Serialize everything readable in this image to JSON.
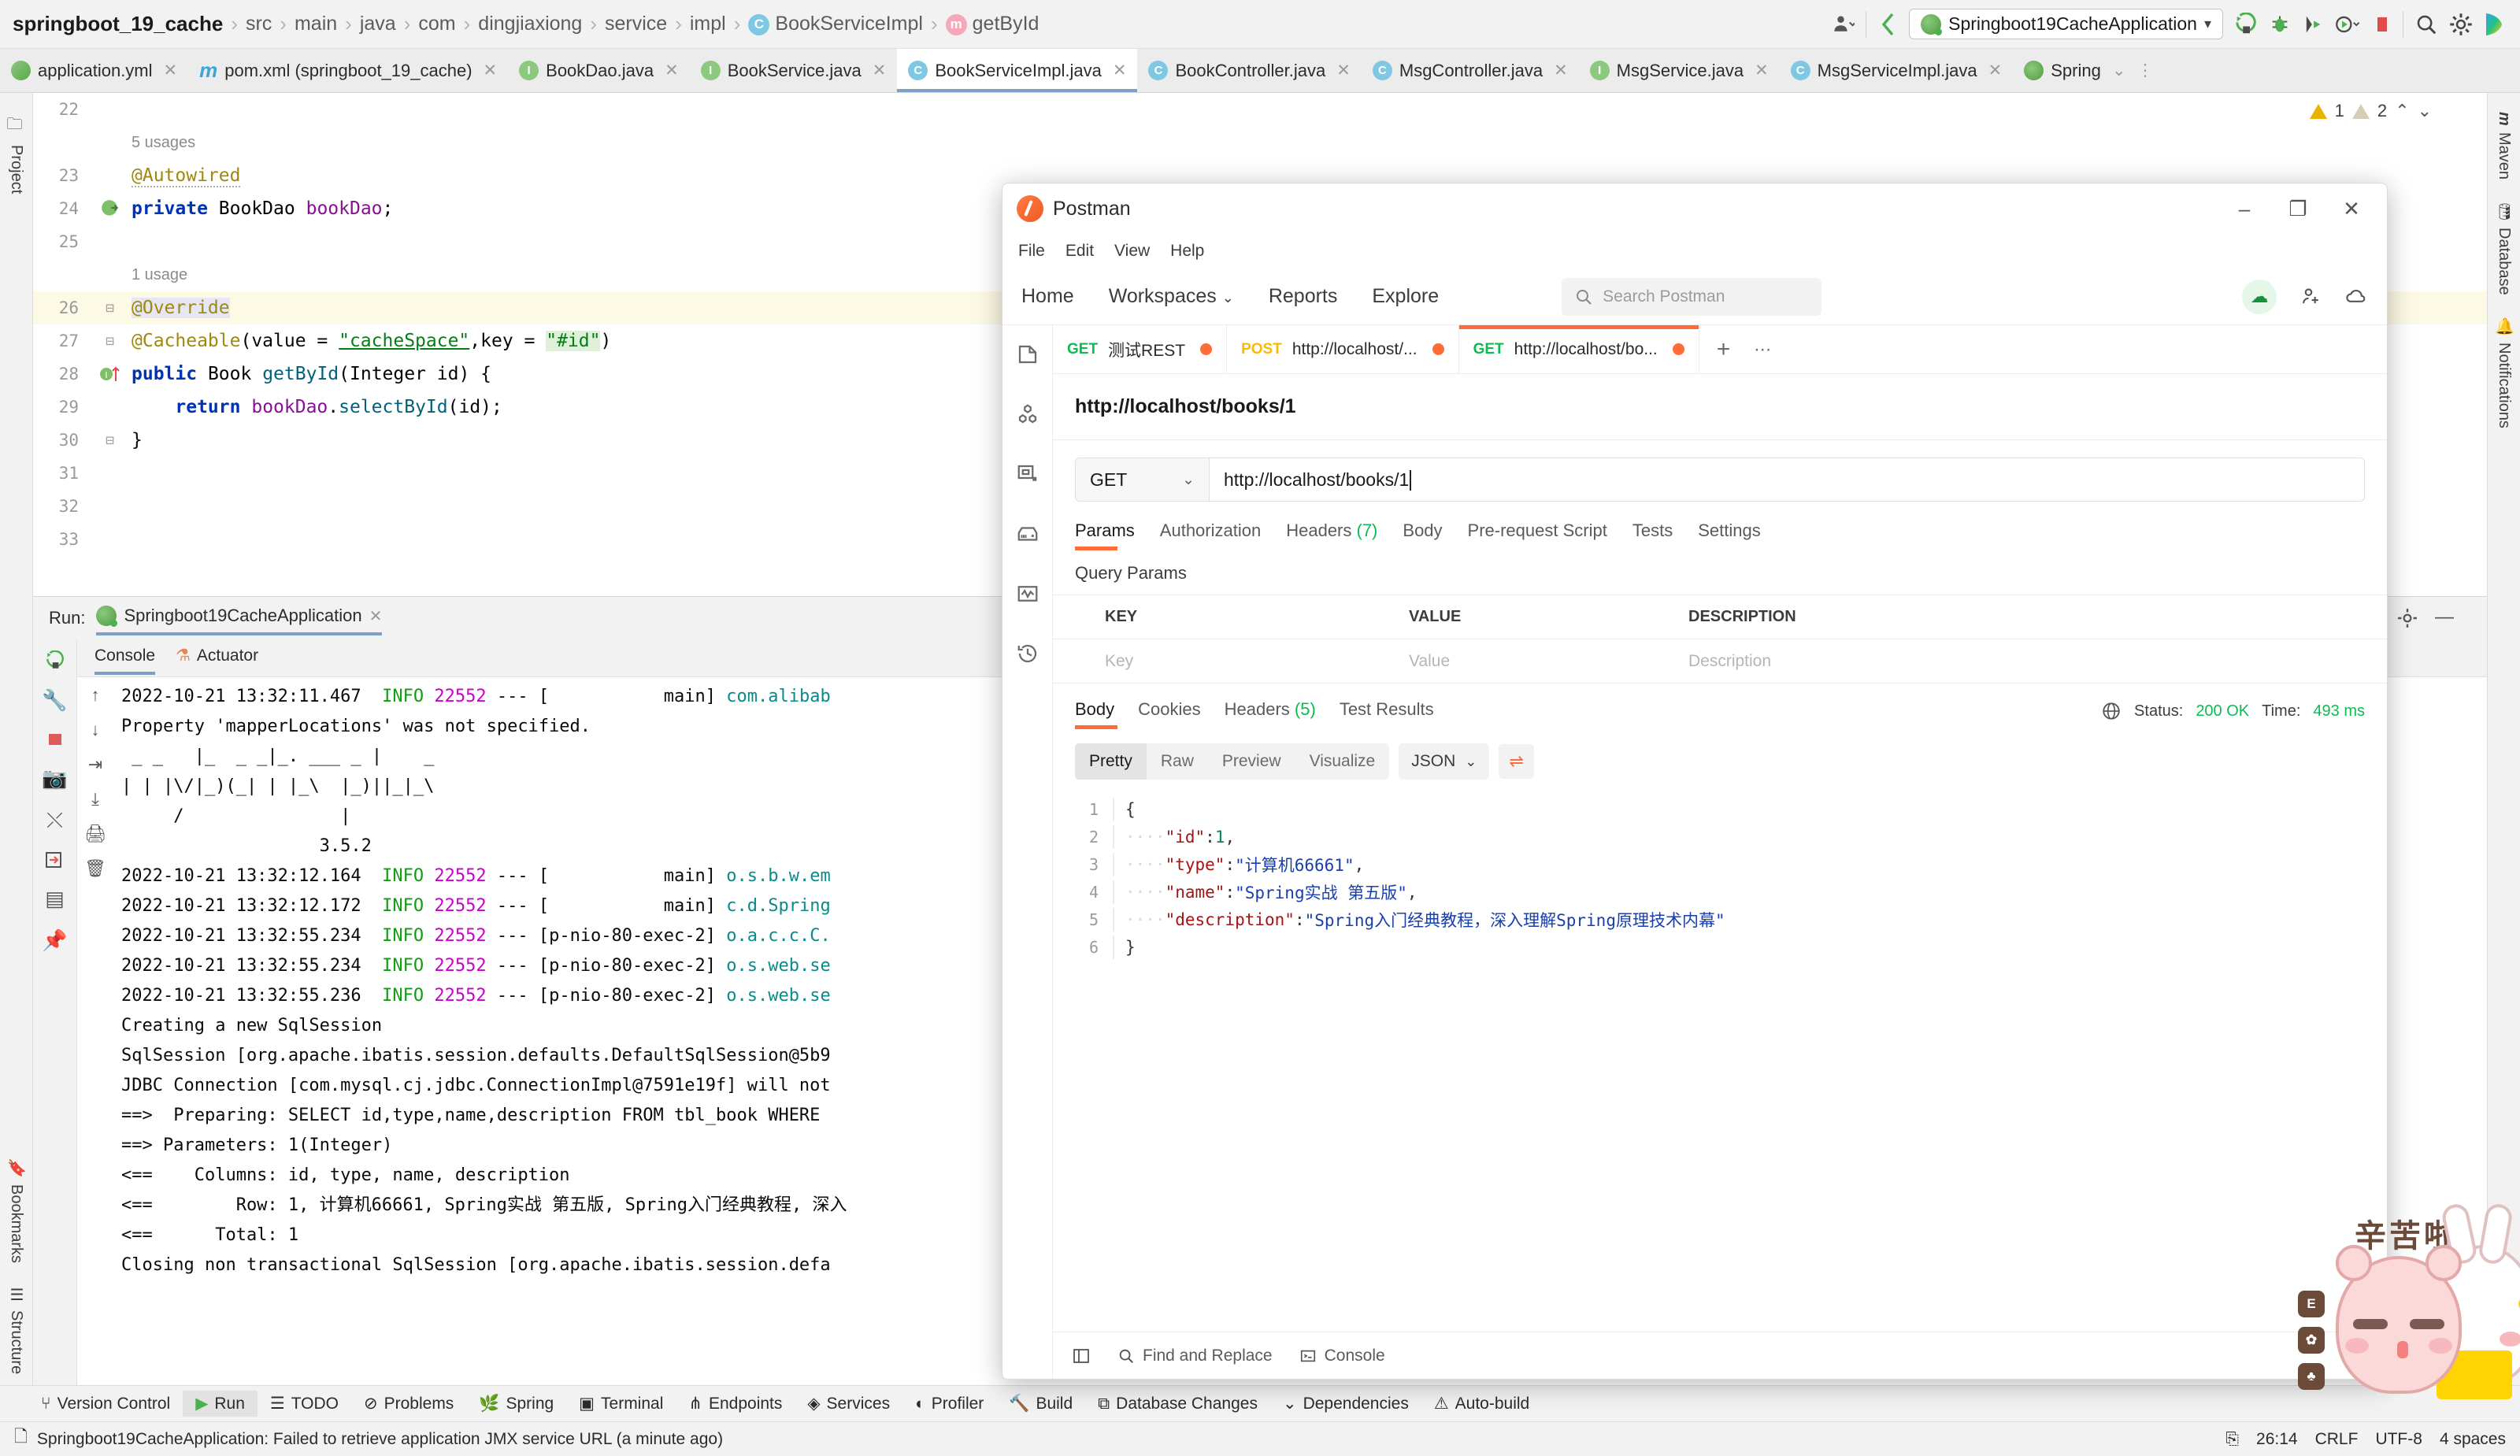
{
  "ide": {
    "breadcrumb": [
      {
        "label": "springboot_19_cache",
        "icon": "",
        "bold": true
      },
      {
        "label": "src",
        "icon": ""
      },
      {
        "label": "main",
        "icon": ""
      },
      {
        "label": "java",
        "icon": ""
      },
      {
        "label": "com",
        "icon": ""
      },
      {
        "label": "dingjiaxiong",
        "icon": ""
      },
      {
        "label": "service",
        "icon": ""
      },
      {
        "label": "impl",
        "icon": ""
      },
      {
        "label": "BookServiceImpl",
        "icon": "class-icon"
      },
      {
        "label": "getById",
        "icon": "method-icon"
      }
    ],
    "toolbar": {
      "run_config": "Springboot19CacheApplication",
      "run_icon": "run-icon",
      "debug_icon": "debug-icon",
      "coverage_icon": "coverage-icon",
      "profile_icon": "profile-icon",
      "stop_icon": "stop-icon",
      "search_icon": "search-icon",
      "settings_icon": "gear-icon",
      "user_icon": "user-icon",
      "back_icon": "back-arrow-icon"
    },
    "editor_tabs": [
      {
        "label": "application.yml",
        "icon": "yml-icon",
        "active": false
      },
      {
        "label": "pom.xml (springboot_19_cache)",
        "icon": "maven-icon",
        "active": false
      },
      {
        "label": "BookDao.java",
        "icon": "interface-icon",
        "active": false
      },
      {
        "label": "BookService.java",
        "icon": "interface-icon",
        "active": false
      },
      {
        "label": "BookServiceImpl.java",
        "icon": "class-icon",
        "active": true
      },
      {
        "label": "BookController.java",
        "icon": "class-icon",
        "active": false
      },
      {
        "label": "MsgController.java",
        "icon": "class-icon",
        "active": false
      },
      {
        "label": "MsgService.java",
        "icon": "interface-icon",
        "active": false
      },
      {
        "label": "MsgServiceImpl.java",
        "icon": "class-icon",
        "active": false
      },
      {
        "label": "Spring",
        "icon": "spring-icon",
        "active": false
      }
    ],
    "inspections": {
      "warnings": "1",
      "weak_warnings": "2"
    },
    "code": {
      "lines": [
        {
          "num": "22",
          "text": ""
        },
        {
          "num": "",
          "text": "5 usages",
          "kind": "usage"
        },
        {
          "num": "23",
          "text": "@Autowired",
          "kind": "annotation-squiggle"
        },
        {
          "num": "24",
          "text": "private BookDao bookDao;",
          "kind": "field",
          "gutter_icon": "bean-icon"
        },
        {
          "num": "25",
          "text": ""
        },
        {
          "num": "",
          "text": "1 usage",
          "kind": "usage"
        },
        {
          "num": "26",
          "text": "@Override",
          "kind": "override",
          "highlight": true,
          "fold": true
        },
        {
          "num": "27",
          "text": "@Cacheable(value = \"cacheSpace\",key = \"#id\")",
          "kind": "cacheable",
          "fold": true
        },
        {
          "num": "28",
          "text": "public Book getById(Integer id) {",
          "kind": "method",
          "gutter_icon": "implements-icon",
          "fold": true
        },
        {
          "num": "29",
          "text": "    return bookDao.selectById(id);",
          "kind": "return"
        },
        {
          "num": "30",
          "text": "}",
          "kind": "brace",
          "fold": true
        },
        {
          "num": "31",
          "text": ""
        },
        {
          "num": "32",
          "text": ""
        },
        {
          "num": "33",
          "text": ""
        }
      ]
    },
    "left_rail": [
      {
        "label": "Project",
        "icon": "project-icon"
      },
      {
        "label": "Bookmarks",
        "icon": "bookmark-icon"
      },
      {
        "label": "Structure",
        "icon": "structure-icon"
      }
    ],
    "right_rail": [
      {
        "label": "Maven",
        "icon": "maven-icon"
      },
      {
        "label": "Database",
        "icon": "database-icon"
      },
      {
        "label": "Notifications",
        "icon": "bell-icon"
      }
    ],
    "run_panel": {
      "label": "Run:",
      "config_name": "Springboot19CacheApplication",
      "tabs": [
        {
          "label": "Console",
          "icon": "console-icon",
          "active": true
        },
        {
          "label": "Actuator",
          "icon": "actuator-icon",
          "active": false
        }
      ],
      "console_lines": [
        "2022-10-21 13:32:11.467  <I>INFO</I> <P>22552</P> --- [           main] <C>com.alibab</C>",
        "Property 'mapperLocations' was not specified.",
        " _ _   |_  _ _|_. ___ _ |    _ ",
        "| | |\\/|_)(_| | |_\\  |_)||_|_\\ ",
        "     /               |         ",
        "                   3.5.2        ",
        "2022-10-21 13:32:12.164  <I>INFO</I> <P>22552</P> --- [           main] <C>o.s.b.w.em</C>",
        "2022-10-21 13:32:12.172  <I>INFO</I> <P>22552</P> --- [           main] <C>c.d.Spring</C>",
        "2022-10-21 13:32:55.234  <I>INFO</I> <P>22552</P> --- [p-nio-80-exec-2] <C>o.a.c.c.C.</C>",
        "2022-10-21 13:32:55.234  <I>INFO</I> <P>22552</P> --- [p-nio-80-exec-2] <C>o.s.web.se</C>",
        "2022-10-21 13:32:55.236  <I>INFO</I> <P>22552</P> --- [p-nio-80-exec-2] <C>o.s.web.se</C>",
        "Creating a new SqlSession",
        "SqlSession [org.apache.ibatis.session.defaults.DefaultSqlSession@5b9",
        "JDBC Connection [com.mysql.cj.jdbc.ConnectionImpl@7591e19f] will not",
        "==>  Preparing: SELECT id,type,name,description FROM tbl_book WHERE",
        "==> Parameters: 1(Integer)",
        "<==    Columns: id, type, name, description",
        "<==        Row: 1, 计算机66661, Spring实战 第五版, Spring入门经典教程, 深入",
        "<==      Total: 1",
        "Closing non transactional SqlSession [org.apache.ibatis.session.defa"
      ]
    },
    "tool_windows": [
      {
        "label": "Version Control",
        "icon": "branch-icon",
        "active": false
      },
      {
        "label": "Run",
        "icon": "run-icon",
        "active": true
      },
      {
        "label": "TODO",
        "icon": "todo-icon",
        "active": false
      },
      {
        "label": "Problems",
        "icon": "problems-icon",
        "active": false
      },
      {
        "label": "Spring",
        "icon": "spring-icon",
        "active": false
      },
      {
        "label": "Terminal",
        "icon": "terminal-icon",
        "active": false
      },
      {
        "label": "Endpoints",
        "icon": "endpoints-icon",
        "active": false
      },
      {
        "label": "Services",
        "icon": "services-icon",
        "active": false
      },
      {
        "label": "Profiler",
        "icon": "profiler-icon",
        "active": false
      },
      {
        "label": "Build",
        "icon": "build-icon",
        "active": false
      },
      {
        "label": "Database Changes",
        "icon": "db-changes-icon",
        "active": false
      },
      {
        "label": "Dependencies",
        "icon": "dependencies-icon",
        "active": false
      },
      {
        "label": "Auto-build",
        "icon": "auto-build-icon",
        "active": false
      }
    ],
    "status_bar": {
      "message": "Springboot19CacheApplication: Failed to retrieve application JMX service URL (a minute ago)",
      "caret": "26:14",
      "line_sep": "CRLF",
      "encoding": "UTF-8",
      "indent": "4 spaces"
    }
  },
  "postman": {
    "title": "Postman",
    "window_buttons": {
      "minimize": "–",
      "maximize": "❐",
      "close": "✕"
    },
    "menu": [
      "File",
      "Edit",
      "View",
      "Help"
    ],
    "nav": [
      "Home",
      "Workspaces",
      "Reports",
      "Explore"
    ],
    "search_placeholder": "Search Postman",
    "rail_icons": [
      "collections-icon",
      "apis-icon",
      "environments-icon",
      "mock-servers-icon",
      "monitors-icon",
      "history-icon"
    ],
    "request_tabs": [
      {
        "method": "GET",
        "label": "测试REST",
        "unsaved": true,
        "active": false
      },
      {
        "method": "POST",
        "label": "http://localhost/...",
        "unsaved": true,
        "active": false
      },
      {
        "method": "GET",
        "label": "http://localhost/bo...",
        "unsaved": true,
        "active": true
      }
    ],
    "tab_add_icon": "plus-icon",
    "tab_more_icon": "ellipsis-icon",
    "request_name": "http://localhost/books/1",
    "method": "GET",
    "url": "http://localhost/books/1",
    "request_tabs_row": [
      {
        "label": "Params",
        "active": true
      },
      {
        "label": "Authorization",
        "active": false
      },
      {
        "label": "Headers",
        "count": "(7)",
        "active": false
      },
      {
        "label": "Body",
        "active": false
      },
      {
        "label": "Pre-request Script",
        "active": false
      },
      {
        "label": "Tests",
        "active": false
      },
      {
        "label": "Settings",
        "active": false
      }
    ],
    "query_params_title": "Query Params",
    "param_table": {
      "headers": [
        "KEY",
        "VALUE",
        "DESCRIPTION"
      ],
      "rows": [
        {
          "key": "Key",
          "value": "Value",
          "description": "Description"
        }
      ]
    },
    "response": {
      "tabs": [
        {
          "label": "Body",
          "active": true
        },
        {
          "label": "Cookies",
          "active": false
        },
        {
          "label": "Headers",
          "count": "(5)",
          "active": false
        },
        {
          "label": "Test Results",
          "active": false
        }
      ],
      "status_label": "Status:",
      "status_value": "200 OK",
      "time_label": "Time:",
      "time_value": "493 ms",
      "globe_icon": "globe-icon",
      "view_modes": [
        "Pretty",
        "Raw",
        "Preview",
        "Visualize"
      ],
      "active_view": "Pretty",
      "format": "JSON",
      "wrap_icon": "wrap-lines-icon",
      "body_lines": [
        {
          "n": "1",
          "content": "{",
          "type": "brace"
        },
        {
          "n": "2",
          "key": "\"id\"",
          "value": "1",
          "value_type": "number",
          "comma": ","
        },
        {
          "n": "3",
          "key": "\"type\"",
          "value": "\"计算机66661\"",
          "value_type": "string",
          "comma": ","
        },
        {
          "n": "4",
          "key": "\"name\"",
          "value": "\"Spring实战 第五版\"",
          "value_type": "string",
          "comma": ","
        },
        {
          "n": "5",
          "key": "\"description\"",
          "value": "\"Spring入门经典教程，深入理解Spring原理技术内幕\"",
          "value_type": "string",
          "comma": ""
        },
        {
          "n": "6",
          "content": "}",
          "type": "brace"
        }
      ]
    },
    "footer": {
      "sidebar_toggle_icon": "sidebar-toggle-icon",
      "find_label": "Find and Replace",
      "find_icon": "search-icon",
      "console_label": "Console",
      "console_icon": "terminal-icon"
    }
  },
  "sticker": {
    "text": "辛苦啦",
    "badges": [
      "E",
      "✿",
      "♣"
    ]
  },
  "colors": {
    "accent_orange": "#ff6c37",
    "ok_green": "#0cbb52",
    "ide_blue": "#7f9fc4"
  }
}
